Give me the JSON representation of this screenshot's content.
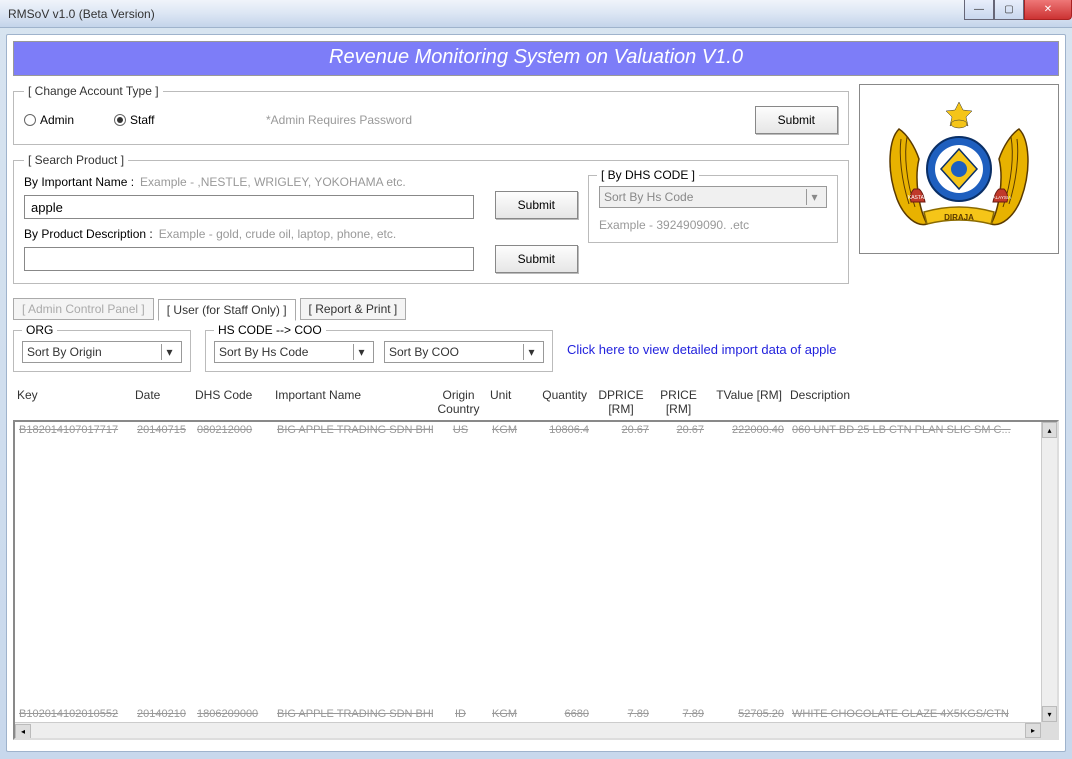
{
  "window": {
    "title": "RMSoV v1.0 (Beta Version)"
  },
  "banner": "Revenue Monitoring System on Valuation V1.0",
  "account": {
    "legend": "[ Change Account Type ]",
    "admin_label": "Admin",
    "staff_label": "Staff",
    "hint": "*Admin Requires Password",
    "submit": "Submit"
  },
  "search": {
    "legend": "[ Search Product ]",
    "by_name_label": "By Important Name :",
    "by_name_hint": "Example - ,NESTLE, WRIGLEY, YOKOHAMA etc.",
    "name_value": "apple",
    "by_desc_label": "By Product Description :",
    "by_desc_hint": "Example - gold, crude oil, laptop, phone, etc.",
    "desc_value": "",
    "submit": "Submit",
    "dhs": {
      "legend": "[ By DHS CODE ]",
      "combo": "Sort By Hs Code",
      "hint": "Example - 3924909090. .etc"
    }
  },
  "tabs": {
    "admin": "[ Admin Control Panel ]",
    "user": "[ User (for Staff Only) ]",
    "report": "[ Report & Print ]"
  },
  "filters": {
    "org_legend": "ORG",
    "org_combo": "Sort By Origin",
    "hs_legend": "HS CODE --> COO",
    "hs_combo": "Sort By Hs Code",
    "coo_combo": "Sort By COO",
    "link": "Click here to view detailed import data of apple"
  },
  "grid": {
    "headers": [
      "Key",
      "Date",
      "DHS Code",
      "Important Name",
      "Origin Country",
      "Unit",
      "Quantity",
      "DPRICE [RM]",
      "PRICE [RM]",
      "TValue [RM]",
      "Description"
    ],
    "top_row": [
      "B182014107017717",
      "20140715",
      "080212000",
      "BIG APPLE TRADING SDN BHD",
      "US",
      "KGM",
      "10806.4",
      "20.67",
      "20.67",
      "222000.40",
      "060 UNT BD 25 LB CTN PLAN SLIC SM C..."
    ],
    "bottom_row": [
      "B102014102010552",
      "20140210",
      "1806209000",
      "BIG APPLE TRADING SDN BHD",
      "ID",
      "KGM",
      "6680",
      "7.89",
      "7.89",
      "52705.20",
      "WHITE CHOCOLATE GLAZE 4X5KGS/CTN"
    ]
  },
  "emblem": {
    "top_text": "",
    "kastam": "KASTAM",
    "malaysia": "MALAYSIA",
    "diraja": "DIRAJA"
  }
}
